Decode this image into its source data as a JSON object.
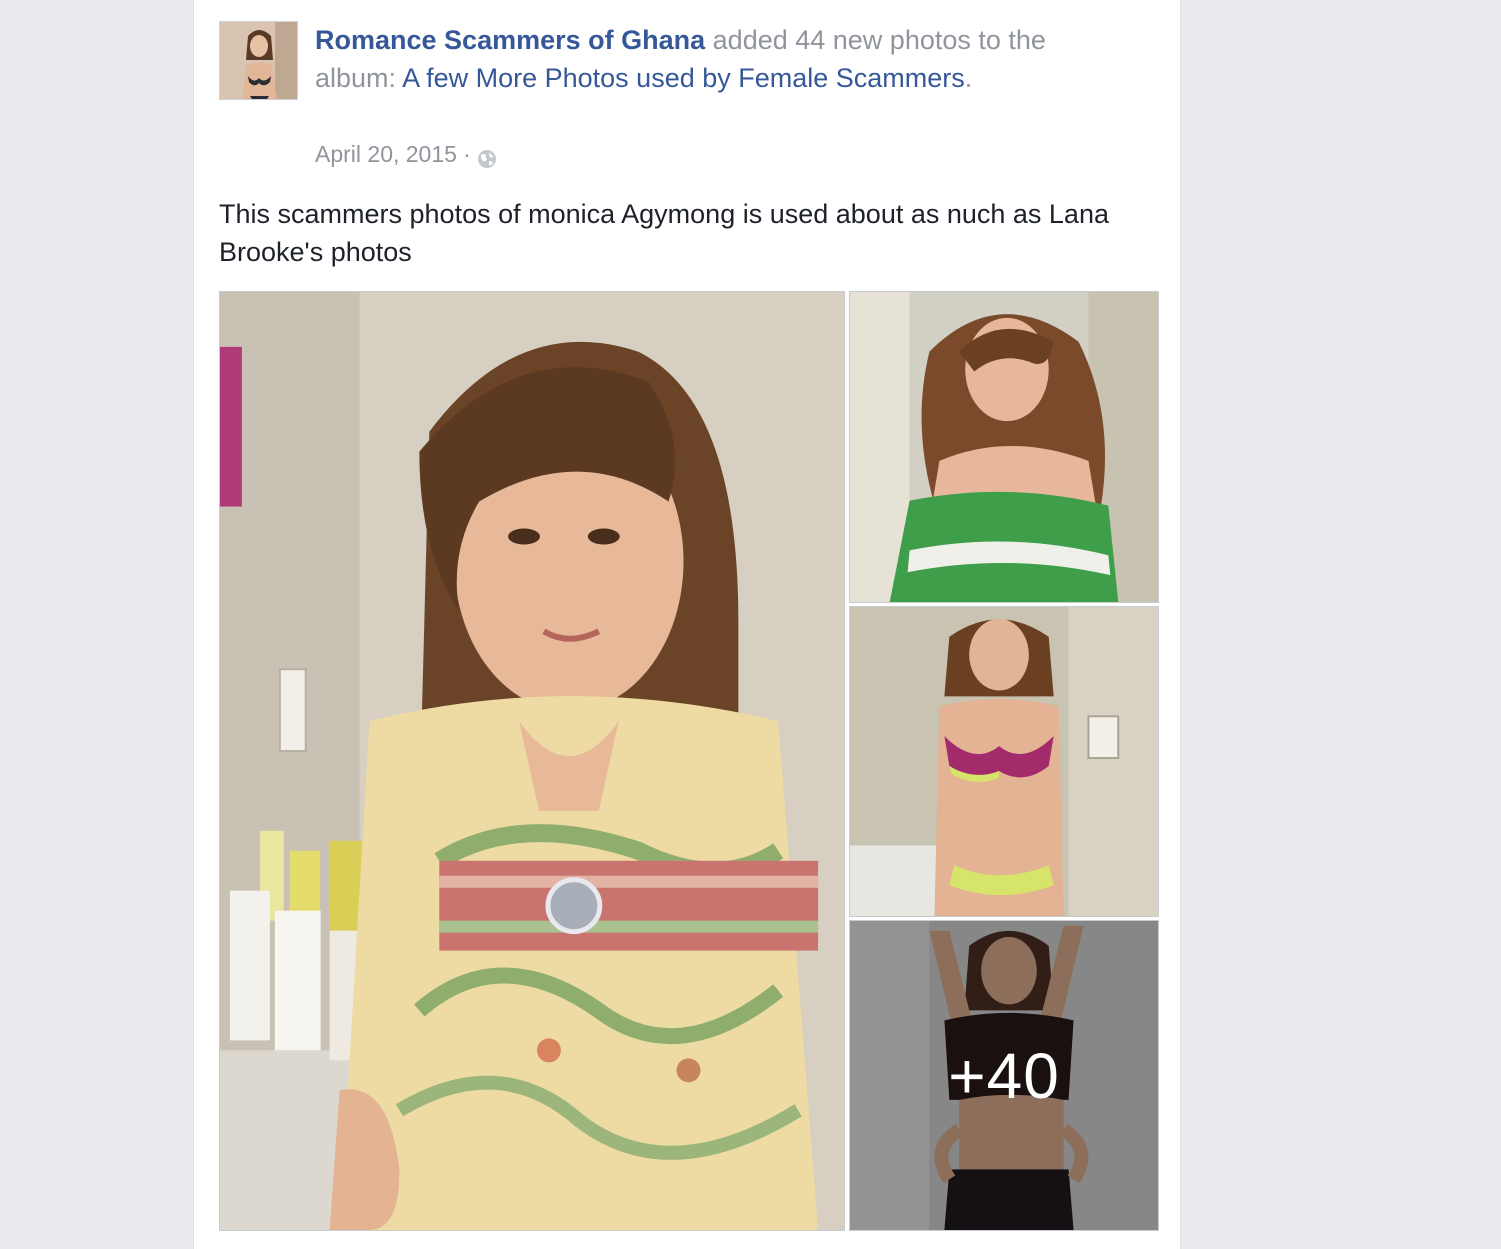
{
  "post": {
    "author": "Romance Scammers of Ghana",
    "action_text": " added 44 new photos to the album: ",
    "album_name": "A few More Photos used by Female Scammers",
    "period": ".",
    "date": "April 20, 2015",
    "separator": "·",
    "privacy_icon": "globe-icon",
    "body_text": "This scammers photos of monica Agymong is used about as nuch as Lana Brooke's photos"
  },
  "photos": {
    "more_count": "+40"
  },
  "colors": {
    "link": "#365899",
    "meta": "#90949c",
    "text": "#1d2129",
    "background": "#e9ebee"
  }
}
